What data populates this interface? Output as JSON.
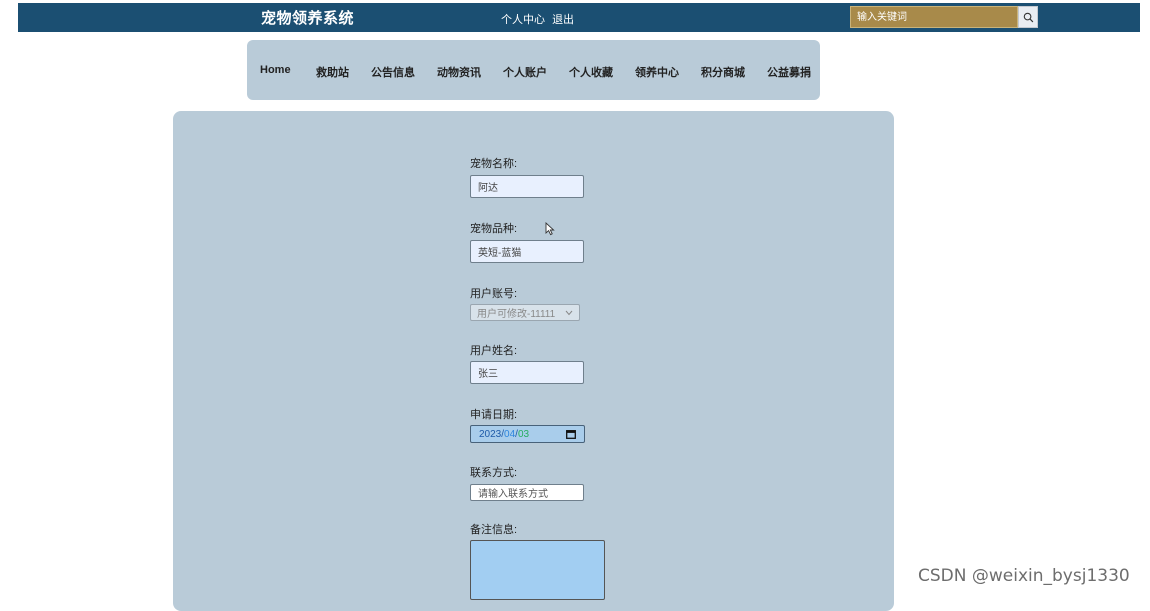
{
  "header": {
    "site_title": "宠物领养系统",
    "user_center": "个人中心",
    "logout": "退出",
    "search_placeholder": "输入关键词"
  },
  "nav": {
    "items": [
      "Home",
      "救助站",
      "公告信息",
      "动物资讯",
      "个人账户",
      "个人收藏",
      "领养中心",
      "积分商城",
      "公益募捐"
    ]
  },
  "form": {
    "pet_name_label": "宠物名称:",
    "pet_name_value": "阿达",
    "pet_breed_label": "宠物品种:",
    "pet_breed_value": "英短-蓝猫",
    "user_account_label": "用户账号:",
    "user_account_value": "用户可修改-11111",
    "user_name_label": "用户姓名:",
    "user_name_value": "张三",
    "apply_date_label": "申请日期:",
    "apply_date_year": "2023",
    "apply_date_sep": "/",
    "apply_date_month": "04",
    "apply_date_day": "03",
    "contact_label": "联系方式:",
    "contact_placeholder": "请输入联系方式",
    "remark_label": "备注信息:"
  },
  "watermark": "CSDN @weixin_bysj1330",
  "colors": {
    "topbar": "#1b4f72",
    "panel": "#b9cbd8",
    "search_bg": "#a88a4a",
    "textarea_bg": "#a2cef2",
    "date_month": "#2e86de",
    "date_day": "#27ae60"
  }
}
